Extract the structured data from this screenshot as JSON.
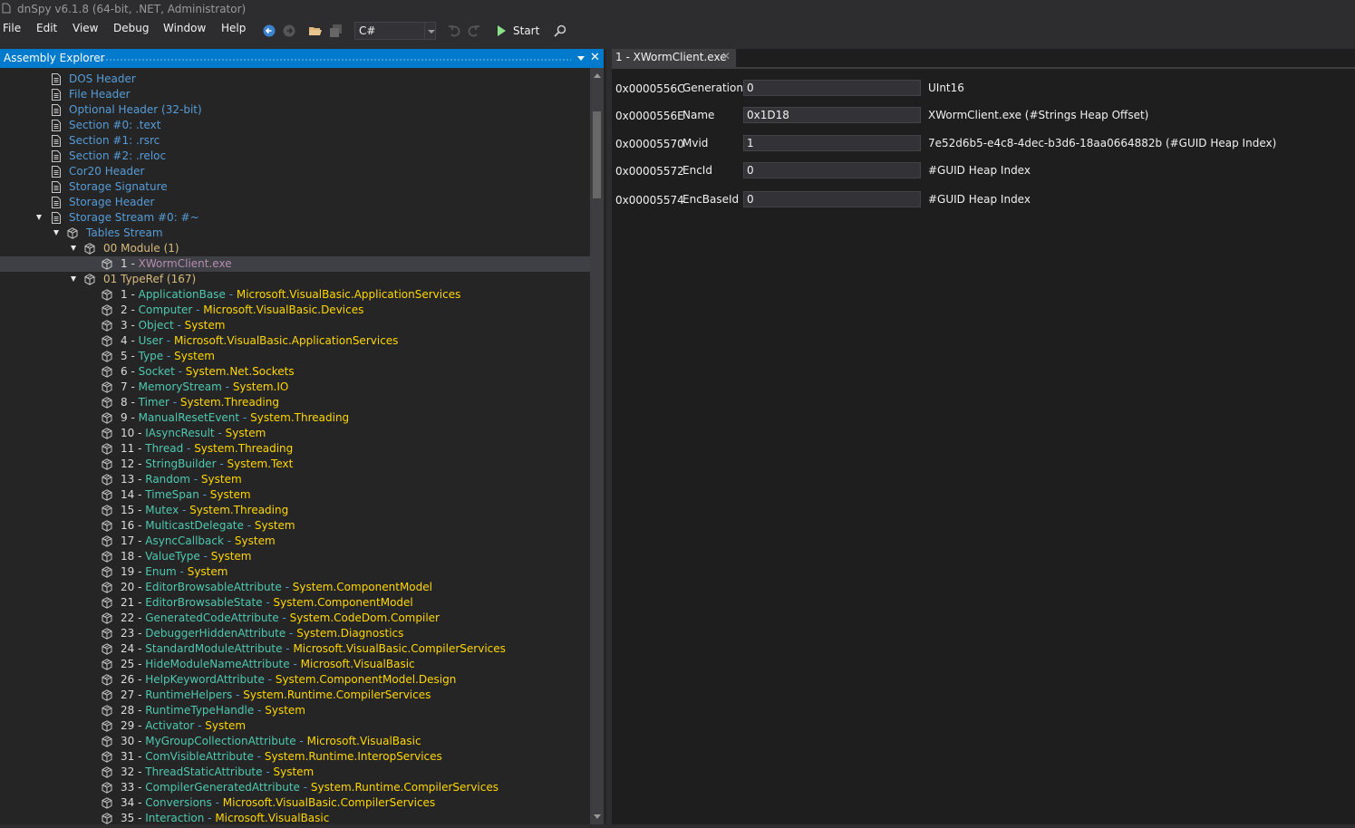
{
  "window": {
    "title": "dnSpy v6.1.8 (64-bit, .NET, Administrator)"
  },
  "menu": [
    "File",
    "Edit",
    "View",
    "Debug",
    "Window",
    "Help"
  ],
  "toolbar": {
    "language": "C#",
    "start_label": "Start"
  },
  "left_panel": {
    "title": "Assembly Explorer"
  },
  "tree": {
    "headers": [
      "DOS Header",
      "File Header",
      "Optional Header (32-bit)",
      "Section #0: .text",
      "Section #1: .rsrc",
      "Section #2: .reloc",
      "Cor20 Header",
      "Storage Signature",
      "Storage Header",
      "Storage Stream #0: #~"
    ],
    "tables_stream": "Tables Stream",
    "module_table": {
      "num": "00",
      "name": "Module",
      "count": "(1)"
    },
    "module_entry": {
      "num": "1 -",
      "name": "XWormClient.exe"
    },
    "typeref_table": {
      "num": "01",
      "name": "TypeRef",
      "count": "(167)"
    },
    "typeref_rows": [
      {
        "n": "1 -",
        "name": "ApplicationBase",
        "ns": "Microsoft.VisualBasic.ApplicationServices"
      },
      {
        "n": "2 -",
        "name": "Computer",
        "ns": "Microsoft.VisualBasic.Devices"
      },
      {
        "n": "3 -",
        "name": "Object",
        "ns": "System"
      },
      {
        "n": "4 -",
        "name": "User",
        "ns": "Microsoft.VisualBasic.ApplicationServices"
      },
      {
        "n": "5 -",
        "name": "Type",
        "ns": "System"
      },
      {
        "n": "6 -",
        "name": "Socket",
        "ns": "System.Net.Sockets"
      },
      {
        "n": "7 -",
        "name": "MemoryStream",
        "ns": "System.IO"
      },
      {
        "n": "8 -",
        "name": "Timer",
        "ns": "System.Threading"
      },
      {
        "n": "9 -",
        "name": "ManualResetEvent",
        "ns": "System.Threading"
      },
      {
        "n": "10 -",
        "name": "IAsyncResult",
        "ns": "System"
      },
      {
        "n": "11 -",
        "name": "Thread",
        "ns": "System.Threading"
      },
      {
        "n": "12 -",
        "name": "StringBuilder",
        "ns": "System.Text"
      },
      {
        "n": "13 -",
        "name": "Random",
        "ns": "System"
      },
      {
        "n": "14 -",
        "name": "TimeSpan",
        "ns": "System"
      },
      {
        "n": "15 -",
        "name": "Mutex",
        "ns": "System.Threading"
      },
      {
        "n": "16 -",
        "name": "MulticastDelegate",
        "ns": "System"
      },
      {
        "n": "17 -",
        "name": "AsyncCallback",
        "ns": "System"
      },
      {
        "n": "18 -",
        "name": "ValueType",
        "ns": "System"
      },
      {
        "n": "19 -",
        "name": "Enum",
        "ns": "System"
      },
      {
        "n": "20 -",
        "name": "EditorBrowsableAttribute",
        "ns": "System.ComponentModel"
      },
      {
        "n": "21 -",
        "name": "EditorBrowsableState",
        "ns": "System.ComponentModel"
      },
      {
        "n": "22 -",
        "name": "GeneratedCodeAttribute",
        "ns": "System.CodeDom.Compiler"
      },
      {
        "n": "23 -",
        "name": "DebuggerHiddenAttribute",
        "ns": "System.Diagnostics"
      },
      {
        "n": "24 -",
        "name": "StandardModuleAttribute",
        "ns": "Microsoft.VisualBasic.CompilerServices"
      },
      {
        "n": "25 -",
        "name": "HideModuleNameAttribute",
        "ns": "Microsoft.VisualBasic"
      },
      {
        "n": "26 -",
        "name": "HelpKeywordAttribute",
        "ns": "System.ComponentModel.Design"
      },
      {
        "n": "27 -",
        "name": "RuntimeHelpers",
        "ns": "System.Runtime.CompilerServices"
      },
      {
        "n": "28 -",
        "name": "RuntimeTypeHandle",
        "ns": "System"
      },
      {
        "n": "29 -",
        "name": "Activator",
        "ns": "System"
      },
      {
        "n": "30 -",
        "name": "MyGroupCollectionAttribute",
        "ns": "Microsoft.VisualBasic"
      },
      {
        "n": "31 -",
        "name": "ComVisibleAttribute",
        "ns": "System.Runtime.InteropServices"
      },
      {
        "n": "32 -",
        "name": "ThreadStaticAttribute",
        "ns": "System"
      },
      {
        "n": "33 -",
        "name": "CompilerGeneratedAttribute",
        "ns": "System.Runtime.CompilerServices"
      },
      {
        "n": "34 -",
        "name": "Conversions",
        "ns": "Microsoft.VisualBasic.CompilerServices"
      },
      {
        "n": "35 -",
        "name": "Interaction",
        "ns": "Microsoft.VisualBasic"
      }
    ]
  },
  "doc_tab": {
    "label": "1 - XWormClient.exe"
  },
  "fields": [
    {
      "offset": "0x0000556C",
      "name": "Generation",
      "value": "0",
      "info": "UInt16"
    },
    {
      "offset": "0x0000556E",
      "name": "Name",
      "value": "0x1D18",
      "info": "XWormClient.exe (#Strings Heap Offset)"
    },
    {
      "offset": "0x00005570",
      "name": "Mvid",
      "value": "1",
      "info": "7e52d6b5-e4c8-4dec-b3d6-18aa0664882b (#GUID Heap Index)"
    },
    {
      "offset": "0x00005572",
      "name": "EncId",
      "value": "0",
      "info": "#GUID Heap Index"
    },
    {
      "offset": "0x00005574",
      "name": "EncBaseId",
      "value": "0",
      "info": "#GUID Heap Index"
    }
  ],
  "colors": {
    "accent": "#007acc",
    "type_name": "#4ec9b0",
    "namespace": "#ffd700",
    "link": "#569cd6"
  }
}
